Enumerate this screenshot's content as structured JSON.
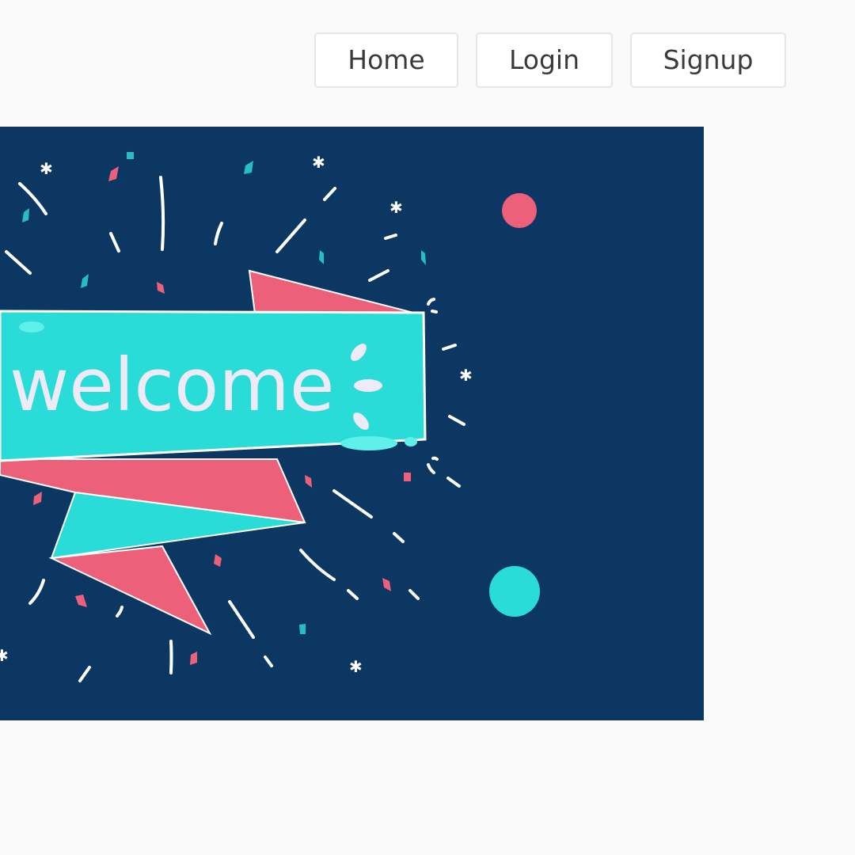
{
  "nav": {
    "items": [
      {
        "label": "Home"
      },
      {
        "label": "Login"
      },
      {
        "label": "Signup"
      }
    ]
  },
  "banner": {
    "text": "welcome",
    "colors": {
      "background": "#0c3763",
      "ribbon_teal": "#2adcd8",
      "ribbon_pink": "#ec6079",
      "text": "#eeeaf8",
      "confetti_white": "#ffffff"
    }
  }
}
